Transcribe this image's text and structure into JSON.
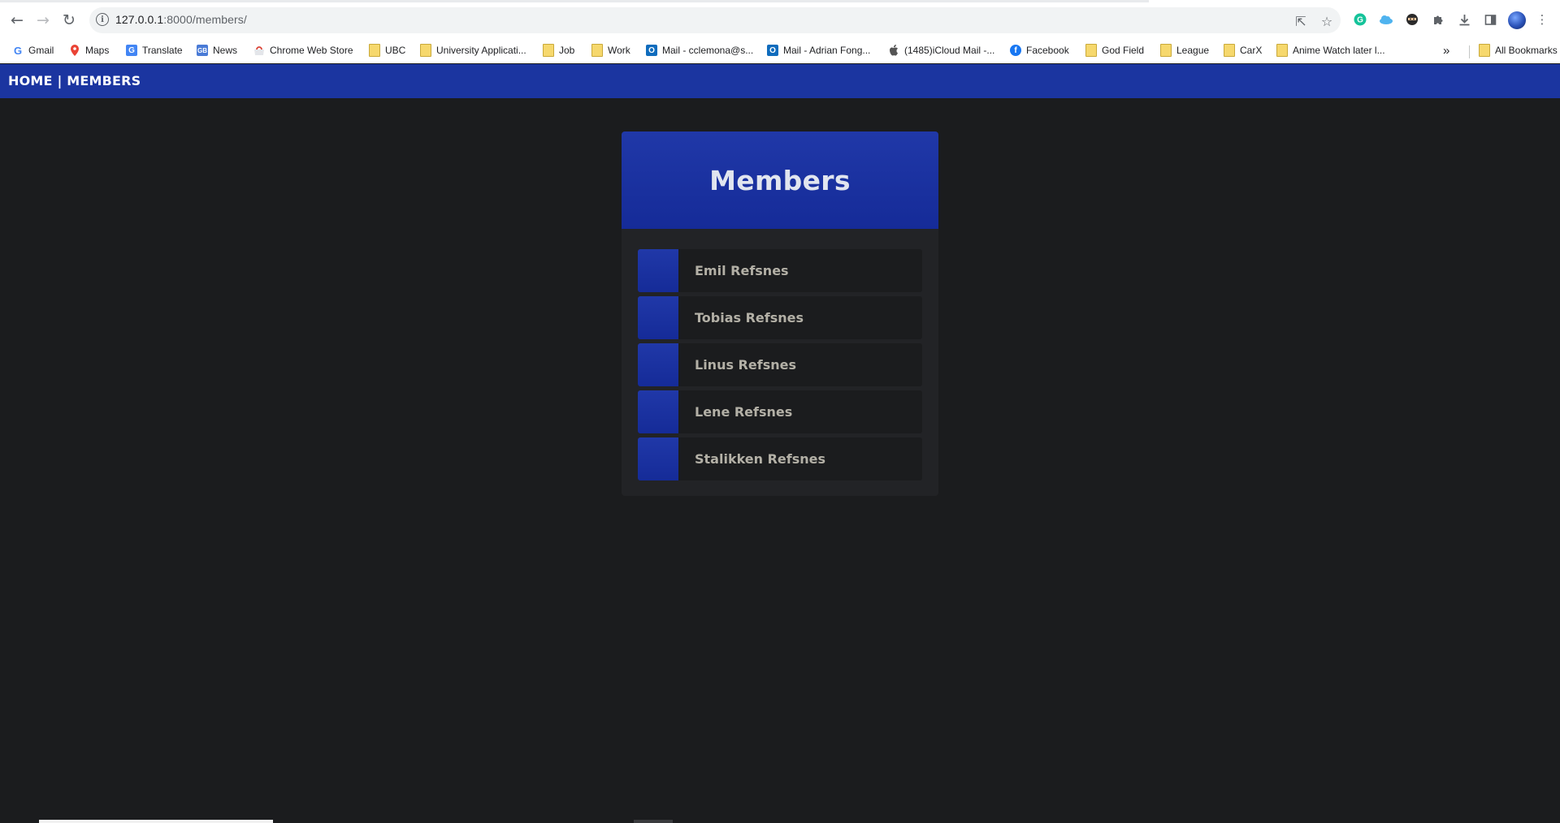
{
  "browser": {
    "url_host": "127.0.0.1",
    "url_path": ":8000/members/",
    "bookmarks": [
      {
        "label": "Gmail",
        "icon": "gmail-icon"
      },
      {
        "label": "Maps",
        "icon": "maps-icon"
      },
      {
        "label": "Translate",
        "icon": "translate-icon"
      },
      {
        "label": "News",
        "icon": "news-icon"
      },
      {
        "label": "Chrome Web Store",
        "icon": "webstore-icon"
      },
      {
        "label": "UBC",
        "icon": "folder-icon"
      },
      {
        "label": "University Applicati...",
        "icon": "folder-icon"
      },
      {
        "label": "Job",
        "icon": "folder-icon"
      },
      {
        "label": "Work",
        "icon": "folder-icon"
      },
      {
        "label": "Mail - cclemona@s...",
        "icon": "outlook-icon"
      },
      {
        "label": "Mail - Adrian Fong...",
        "icon": "outlook-icon"
      },
      {
        "label": "(1485)iCloud Mail -...",
        "icon": "apple-icon"
      },
      {
        "label": "Facebook",
        "icon": "facebook-icon"
      },
      {
        "label": "God Field",
        "icon": "folder-icon"
      },
      {
        "label": "League",
        "icon": "folder-icon"
      },
      {
        "label": "CarX",
        "icon": "folder-icon"
      },
      {
        "label": "Anime Watch later l...",
        "icon": "folder-icon"
      }
    ],
    "overflow_label": "»",
    "all_bookmarks_label": "All Bookmarks"
  },
  "site_nav": {
    "home_label": "HOME",
    "separator": "|",
    "members_label": "MEMBERS"
  },
  "page": {
    "title": "Members",
    "members": [
      {
        "name": "Emil Refsnes"
      },
      {
        "name": "Tobias Refsnes"
      },
      {
        "name": "Linus Refsnes"
      },
      {
        "name": "Lene Refsnes"
      },
      {
        "name": "Stalikken Refsnes"
      }
    ]
  },
  "colors": {
    "background": "#1b1c1e",
    "nav_bar": "#1b35a0",
    "card_header": "#1a31a0",
    "card_body": "#222326",
    "member_text": "#b3b0a6"
  }
}
